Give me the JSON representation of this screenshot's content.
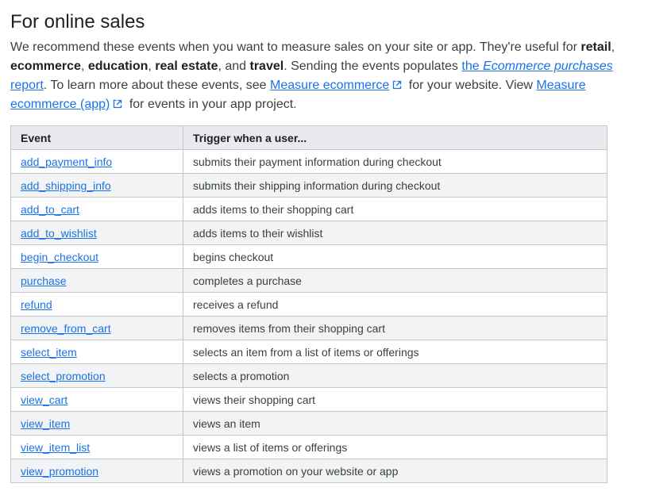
{
  "section": {
    "title": "For online sales"
  },
  "intro": {
    "text1": "We recommend these events when you want to measure sales on your site or app. They're useful for ",
    "b1": "retail",
    "sep1": ", ",
    "b2": "ecommerce",
    "sep2": ", ",
    "b3": "education",
    "sep3": ", ",
    "b4": "real estate",
    "sep4": ", and ",
    "b5": "travel",
    "text2": ". Sending the events populates ",
    "link1_pre": "the ",
    "link1_em": "Ecommerce purchases",
    "link1_post": " report",
    "text3": ". To learn more about these events, see ",
    "link2": "Measure ecommerce",
    "text4": " for your website. View ",
    "link3": "Measure ecommerce (app)",
    "text5": " for events in your app project."
  },
  "icons": {
    "external": "external-link-icon"
  },
  "colors": {
    "link": "#1a73e8",
    "header_bg": "#e8eaed",
    "stripe_bg": "#f1f3f4",
    "border": "#c6c6c6"
  },
  "table": {
    "headers": [
      "Event",
      "Trigger when a user..."
    ],
    "rows": [
      {
        "event": "add_payment_info",
        "trigger": "submits their payment information during checkout"
      },
      {
        "event": "add_shipping_info",
        "trigger": "submits their shipping information during checkout"
      },
      {
        "event": "add_to_cart",
        "trigger": "adds items to their shopping cart"
      },
      {
        "event": "add_to_wishlist",
        "trigger": "adds items to their wishlist"
      },
      {
        "event": "begin_checkout",
        "trigger": "begins checkout"
      },
      {
        "event": "purchase",
        "trigger": "completes a purchase"
      },
      {
        "event": "refund",
        "trigger": "receives a refund"
      },
      {
        "event": "remove_from_cart",
        "trigger": "removes items from their shopping cart"
      },
      {
        "event": "select_item",
        "trigger": "selects an item from a list of items or offerings"
      },
      {
        "event": "select_promotion",
        "trigger": "selects a promotion"
      },
      {
        "event": "view_cart",
        "trigger": "views their shopping cart"
      },
      {
        "event": "view_item",
        "trigger": "views an item"
      },
      {
        "event": "view_item_list",
        "trigger": "views a list of items or offerings"
      },
      {
        "event": "view_promotion",
        "trigger": "views a promotion on your website or app"
      }
    ]
  }
}
